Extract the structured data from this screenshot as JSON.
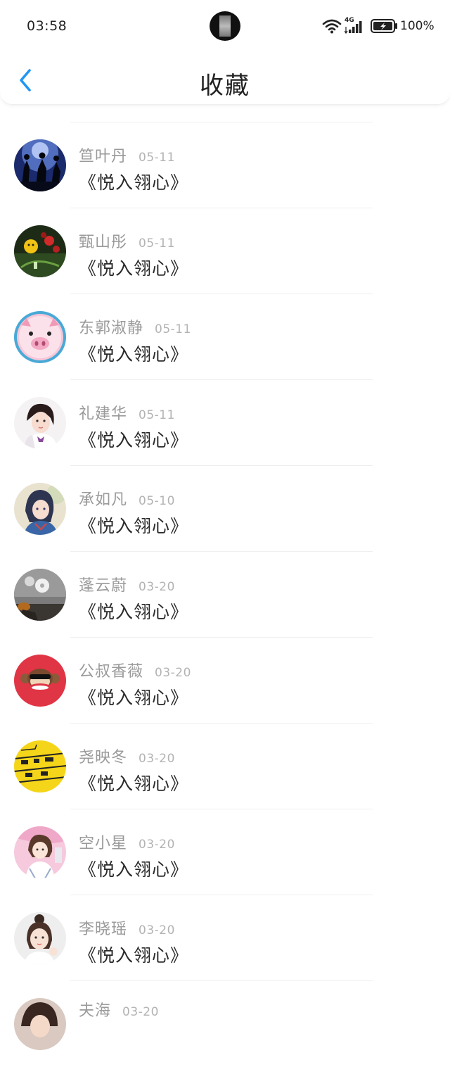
{
  "status_bar": {
    "time": "03:58",
    "network_type": "4G",
    "battery": "100%"
  },
  "nav": {
    "title": "收藏"
  },
  "colors": {
    "accent": "#2196F3",
    "name_text": "#9a9a9a",
    "date_text": "#b3b3b3"
  },
  "items": [
    {
      "name": "笪叶丹",
      "date": "05-11",
      "title": "《悦入翎心》",
      "avatar": "dark-dance-avatar"
    },
    {
      "name": "甄山彤",
      "date": "05-11",
      "title": "《悦入翎心》",
      "avatar": "flower-avatar"
    },
    {
      "name": "东郭淑静",
      "date": "05-11",
      "title": "《悦入翎心》",
      "avatar": "pig-avatar"
    },
    {
      "name": "礼建华",
      "date": "05-11",
      "title": "《悦入翎心》",
      "avatar": "girl-avatar"
    },
    {
      "name": "承如凡",
      "date": "05-10",
      "title": "《悦入翎心》",
      "avatar": "anime-girl-avatar"
    },
    {
      "name": "蓬云蔚",
      "date": "03-20",
      "title": "《悦入翎心》",
      "avatar": "still-life-avatar"
    },
    {
      "name": "公叔香薇",
      "date": "03-20",
      "title": "《悦入翎心》",
      "avatar": "monkey-avatar"
    },
    {
      "name": "尧映冬",
      "date": "03-20",
      "title": "《悦入翎心》",
      "avatar": "yellow-sketch-avatar"
    },
    {
      "name": "空小星",
      "date": "03-20",
      "title": "《悦入翎心》",
      "avatar": "pink-anime-avatar"
    },
    {
      "name": "李晓瑶",
      "date": "03-20",
      "title": "《悦入翎心》",
      "avatar": "portrait-avatar"
    },
    {
      "name": "夫海",
      "date": "03-20",
      "title": "",
      "avatar": "partial-avatar"
    }
  ]
}
